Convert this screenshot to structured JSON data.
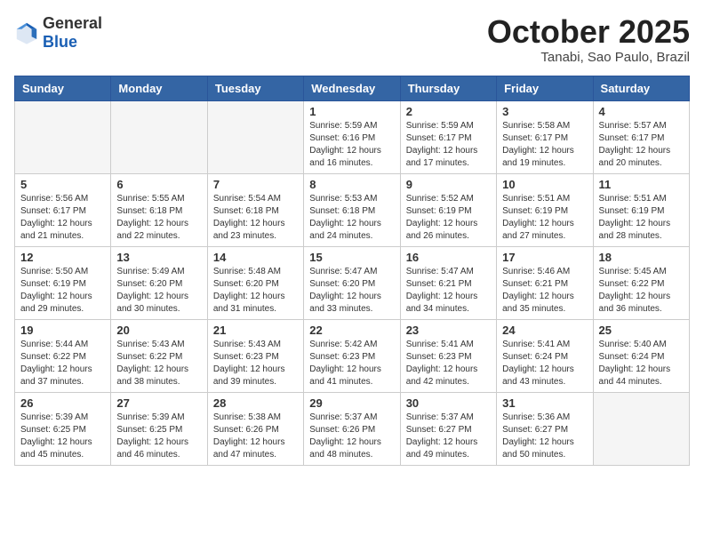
{
  "header": {
    "logo_general": "General",
    "logo_blue": "Blue",
    "month": "October 2025",
    "location": "Tanabi, Sao Paulo, Brazil"
  },
  "weekdays": [
    "Sunday",
    "Monday",
    "Tuesday",
    "Wednesday",
    "Thursday",
    "Friday",
    "Saturday"
  ],
  "weeks": [
    [
      {
        "day": "",
        "info": ""
      },
      {
        "day": "",
        "info": ""
      },
      {
        "day": "",
        "info": ""
      },
      {
        "day": "1",
        "info": "Sunrise: 5:59 AM\nSunset: 6:16 PM\nDaylight: 12 hours and 16 minutes."
      },
      {
        "day": "2",
        "info": "Sunrise: 5:59 AM\nSunset: 6:17 PM\nDaylight: 12 hours and 17 minutes."
      },
      {
        "day": "3",
        "info": "Sunrise: 5:58 AM\nSunset: 6:17 PM\nDaylight: 12 hours and 19 minutes."
      },
      {
        "day": "4",
        "info": "Sunrise: 5:57 AM\nSunset: 6:17 PM\nDaylight: 12 hours and 20 minutes."
      }
    ],
    [
      {
        "day": "5",
        "info": "Sunrise: 5:56 AM\nSunset: 6:17 PM\nDaylight: 12 hours and 21 minutes."
      },
      {
        "day": "6",
        "info": "Sunrise: 5:55 AM\nSunset: 6:18 PM\nDaylight: 12 hours and 22 minutes."
      },
      {
        "day": "7",
        "info": "Sunrise: 5:54 AM\nSunset: 6:18 PM\nDaylight: 12 hours and 23 minutes."
      },
      {
        "day": "8",
        "info": "Sunrise: 5:53 AM\nSunset: 6:18 PM\nDaylight: 12 hours and 24 minutes."
      },
      {
        "day": "9",
        "info": "Sunrise: 5:52 AM\nSunset: 6:19 PM\nDaylight: 12 hours and 26 minutes."
      },
      {
        "day": "10",
        "info": "Sunrise: 5:51 AM\nSunset: 6:19 PM\nDaylight: 12 hours and 27 minutes."
      },
      {
        "day": "11",
        "info": "Sunrise: 5:51 AM\nSunset: 6:19 PM\nDaylight: 12 hours and 28 minutes."
      }
    ],
    [
      {
        "day": "12",
        "info": "Sunrise: 5:50 AM\nSunset: 6:19 PM\nDaylight: 12 hours and 29 minutes."
      },
      {
        "day": "13",
        "info": "Sunrise: 5:49 AM\nSunset: 6:20 PM\nDaylight: 12 hours and 30 minutes."
      },
      {
        "day": "14",
        "info": "Sunrise: 5:48 AM\nSunset: 6:20 PM\nDaylight: 12 hours and 31 minutes."
      },
      {
        "day": "15",
        "info": "Sunrise: 5:47 AM\nSunset: 6:20 PM\nDaylight: 12 hours and 33 minutes."
      },
      {
        "day": "16",
        "info": "Sunrise: 5:47 AM\nSunset: 6:21 PM\nDaylight: 12 hours and 34 minutes."
      },
      {
        "day": "17",
        "info": "Sunrise: 5:46 AM\nSunset: 6:21 PM\nDaylight: 12 hours and 35 minutes."
      },
      {
        "day": "18",
        "info": "Sunrise: 5:45 AM\nSunset: 6:22 PM\nDaylight: 12 hours and 36 minutes."
      }
    ],
    [
      {
        "day": "19",
        "info": "Sunrise: 5:44 AM\nSunset: 6:22 PM\nDaylight: 12 hours and 37 minutes."
      },
      {
        "day": "20",
        "info": "Sunrise: 5:43 AM\nSunset: 6:22 PM\nDaylight: 12 hours and 38 minutes."
      },
      {
        "day": "21",
        "info": "Sunrise: 5:43 AM\nSunset: 6:23 PM\nDaylight: 12 hours and 39 minutes."
      },
      {
        "day": "22",
        "info": "Sunrise: 5:42 AM\nSunset: 6:23 PM\nDaylight: 12 hours and 41 minutes."
      },
      {
        "day": "23",
        "info": "Sunrise: 5:41 AM\nSunset: 6:23 PM\nDaylight: 12 hours and 42 minutes."
      },
      {
        "day": "24",
        "info": "Sunrise: 5:41 AM\nSunset: 6:24 PM\nDaylight: 12 hours and 43 minutes."
      },
      {
        "day": "25",
        "info": "Sunrise: 5:40 AM\nSunset: 6:24 PM\nDaylight: 12 hours and 44 minutes."
      }
    ],
    [
      {
        "day": "26",
        "info": "Sunrise: 5:39 AM\nSunset: 6:25 PM\nDaylight: 12 hours and 45 minutes."
      },
      {
        "day": "27",
        "info": "Sunrise: 5:39 AM\nSunset: 6:25 PM\nDaylight: 12 hours and 46 minutes."
      },
      {
        "day": "28",
        "info": "Sunrise: 5:38 AM\nSunset: 6:26 PM\nDaylight: 12 hours and 47 minutes."
      },
      {
        "day": "29",
        "info": "Sunrise: 5:37 AM\nSunset: 6:26 PM\nDaylight: 12 hours and 48 minutes."
      },
      {
        "day": "30",
        "info": "Sunrise: 5:37 AM\nSunset: 6:27 PM\nDaylight: 12 hours and 49 minutes."
      },
      {
        "day": "31",
        "info": "Sunrise: 5:36 AM\nSunset: 6:27 PM\nDaylight: 12 hours and 50 minutes."
      },
      {
        "day": "",
        "info": ""
      }
    ]
  ]
}
